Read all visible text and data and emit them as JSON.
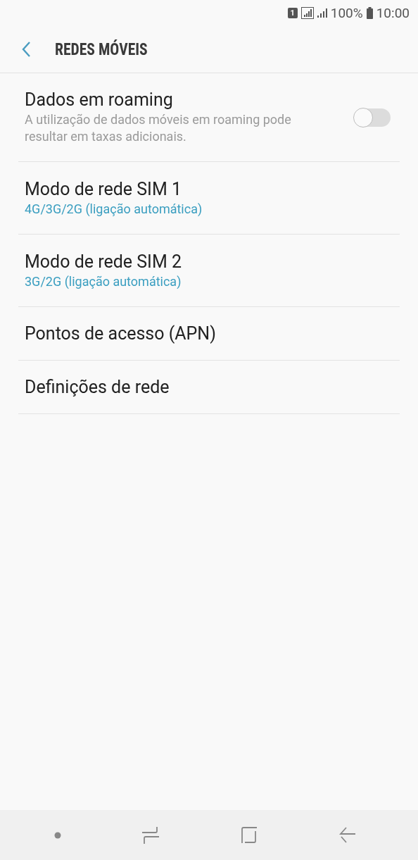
{
  "status_bar": {
    "sim_badge": "1",
    "battery": "100%",
    "time": "10:00"
  },
  "header": {
    "title": "REDES MÓVEIS"
  },
  "items": [
    {
      "kind": "toggle",
      "title": "Dados em roaming",
      "summary": "A utilização de dados móveis em roaming pode resultar em taxas adicionais.",
      "on": false
    },
    {
      "kind": "value",
      "title": "Modo de rede SIM 1",
      "summary": "4G/3G/2G (ligação automática)"
    },
    {
      "kind": "value",
      "title": "Modo de rede SIM 2",
      "summary": "3G/2G (ligação automática)"
    },
    {
      "kind": "plain",
      "title": "Pontos de acesso (APN)"
    },
    {
      "kind": "plain",
      "title": "Definições de rede"
    }
  ]
}
